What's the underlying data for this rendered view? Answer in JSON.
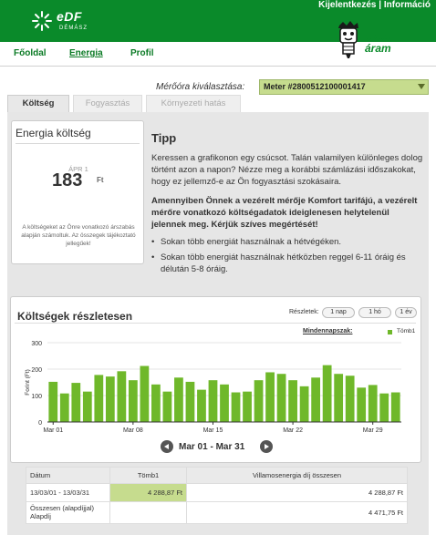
{
  "header": {
    "logo_text": "eDF",
    "logo_sub": "DÉMÁSZ",
    "links": [
      "Kijelentkezés",
      "Információ"
    ],
    "link_separator": "|",
    "okos_line1": "okos",
    "okos_line2": "áram"
  },
  "nav": {
    "items": [
      {
        "label": "Főoldal",
        "active": false
      },
      {
        "label": "Energia",
        "active": true
      },
      {
        "label": "Profil",
        "active": false
      }
    ]
  },
  "meter": {
    "label": "Mérőóra kiválasztása:",
    "selected": "Meter #2800512100001417"
  },
  "tabs": [
    {
      "label": "Költség",
      "active": true
    },
    {
      "label": "Fogyasztás",
      "active": false
    },
    {
      "label": "Környezeti hatás",
      "active": false
    }
  ],
  "cost": {
    "title": "Energia költség",
    "period": "ÁPR 1",
    "value": "183",
    "unit": "Ft",
    "note": "A költségeket az Önre vonatkozó árszabás alapján számoltuk. Az összegek tájékoztató jellegűek!"
  },
  "tipp": {
    "title": "Tipp",
    "paragraph": "Keressen a grafikonon egy csúcsot. Talán valamilyen különleges dolog történt azon a napon? Nézze meg a korábbi számlázási időszakokat, hogy ez jellemző-e az Ön fogyasztási szokásaira.",
    "bold": "Amennyiben Önnek a vezérelt mérője Komfort tarifájú, a vezérelt mérőre vonatkozó költségadatok ideiglenesen helytelenül jelennek meg. Kérjük szíves megértését!",
    "bullets": [
      "Sokan több energiát használnak a hétvégéken.",
      "Sokan több energiát használnak hétközben reggel 6-11 óráig és délután 5-8 óráig."
    ]
  },
  "details": {
    "title": "Költségek részletesen",
    "resolution_label": "Részletek:",
    "resolution_buttons": [
      "1 nap",
      "1 hó",
      "1 év"
    ],
    "legend_period": "Mindennapszak:",
    "range": "Mar 01 - Mar 31"
  },
  "chart_data": {
    "type": "bar",
    "ylabel": "Forint (Ft)",
    "ylim": [
      0,
      300
    ],
    "yticks": [
      "300",
      "200",
      "100",
      "0"
    ],
    "xtick_labels": [
      "Mar 01",
      "Mar 08",
      "Mar 15",
      "Mar 22",
      "Mar 29"
    ],
    "series": [
      {
        "name": "Tömb1",
        "color": "#6fb82a",
        "values": [
          152,
          108,
          148,
          115,
          178,
          172,
          192,
          158,
          212,
          142,
          115,
          168,
          152,
          122,
          158,
          142,
          112,
          115,
          158,
          188,
          182,
          158,
          135,
          168,
          215,
          182,
          175,
          130,
          140,
          108,
          112
        ]
      }
    ]
  },
  "table": {
    "headers": [
      "Dátum",
      "Tömb1",
      "Villamosenergia díj összesen"
    ],
    "rows": [
      {
        "date": "13/03/01 - 13/03/31",
        "t1": "4 288,87 Ft",
        "total": "4 288,87 Ft"
      },
      {
        "date": "Összesen (alapdíjjal) Alapdíj",
        "t1": "",
        "total": "4 471,75 Ft"
      }
    ]
  }
}
